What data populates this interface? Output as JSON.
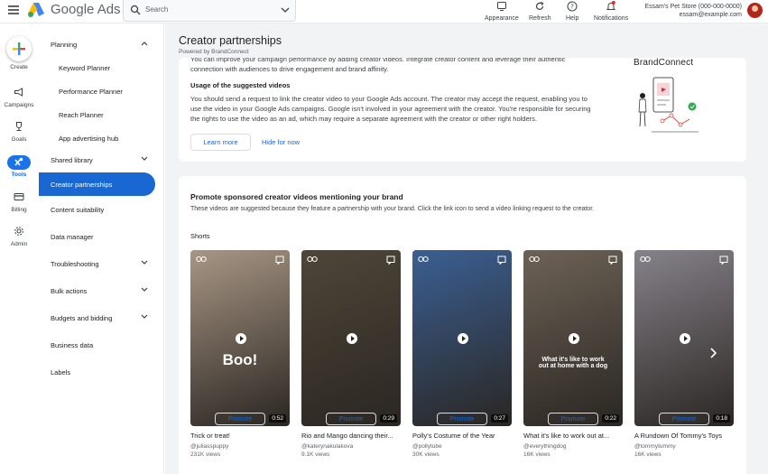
{
  "app": {
    "name": "Google Ads"
  },
  "search": {
    "placeholder": "Search"
  },
  "topbar": {
    "appearance": "Appearance",
    "refresh": "Refresh",
    "help": "Help",
    "notifications": "Notifications",
    "account_name": "Essam's Pet Store (000-000-0000)",
    "account_email": "essam@example.com"
  },
  "rail": {
    "create": "Create",
    "campaigns": "Campaigns",
    "goals": "Goals",
    "tools": "Tools",
    "billing": "Billing",
    "admin": "Admin"
  },
  "sidebar": {
    "planning": "Planning",
    "keyword_planner": "Keyword Planner",
    "performance_planner": "Performance Planner",
    "reach_planner": "Reach Planner",
    "app_advertising_hub": "App advertising hub",
    "shared_library": "Shared library",
    "creator_partnerships": "Creator partnerships",
    "content_suitability": "Content suitability",
    "data_manager": "Data manager",
    "troubleshooting": "Troubleshooting",
    "bulk_actions": "Bulk actions",
    "budgets_and_bidding": "Budgets and bidding",
    "business_data": "Business data",
    "labels": "Labels"
  },
  "page": {
    "title": "Creator partnerships",
    "powered_by": "Powered by BrandConnect"
  },
  "intro_card": {
    "cut_text": "You can improve your campaign performance by adding creator videos. Integrate creator content and leverage their authentic connection with audiences to drive engagement and brand affinity.",
    "heading": "Usage of the suggested videos",
    "body": "You should send a request to link the creator video to your Google Ads account. The creator may accept the request, enabling you to use the video in your Google Ads campaigns. Google isn't involved in your agreement with the creator. You're responsible for securing the rights to use the video as an ad, which may require a separate agreement with the creator or other right holders.",
    "learn_more": "Learn more",
    "hide_for_now": "Hide for now",
    "brand_logo": "BrandConnect"
  },
  "promote_card": {
    "heading": "Promote sponsored creator videos mentioning your brand",
    "description": "These videos are suggested because they feature a partnership with your brand. Click the link icon to send a video linking request to the creator.",
    "section_label": "Shorts",
    "promote_label": "Promote",
    "videos": [
      {
        "title": "Trick or treat!",
        "handle": "@juliasspuppy",
        "views": "231K views",
        "duration": "0:52",
        "overlay": "Boo!",
        "bg": "#a89684"
      },
      {
        "title": "Rio and Mango dancing their...",
        "handle": "@katerynakulakova",
        "views": "9.1K views",
        "duration": "0:29",
        "overlay": "",
        "bg": "#4e4638"
      },
      {
        "title": "Polly's Costume of the Year",
        "handle": "@pollytube",
        "views": "30K views",
        "duration": "0:27",
        "overlay": "",
        "bg": "#3b5f93"
      },
      {
        "title": "What it's like to work out at...",
        "handle": "@everythingdog",
        "views": "16K views",
        "duration": "0:22",
        "overlay": "What it's like to work out at home with a dog",
        "bg": "#6d6256"
      },
      {
        "title": "A Rundown Of Tommy's Toys",
        "handle": "@tommytummy",
        "views": "16K views",
        "duration": "0:18",
        "overlay": "",
        "bg": "#85828a"
      }
    ]
  }
}
